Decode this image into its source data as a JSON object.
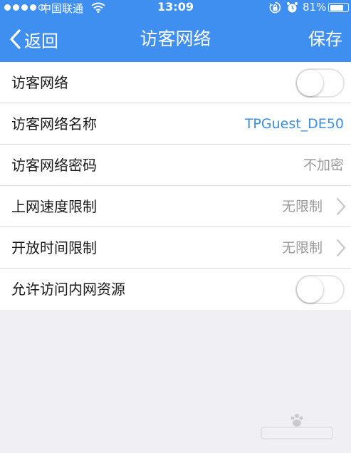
{
  "status_bar": {
    "carrier": "中国联通",
    "time": "13:09",
    "battery_percent": "81%",
    "battery_level": 0.81
  },
  "nav": {
    "back_label": "返回",
    "title": "访客网络",
    "save_label": "保存"
  },
  "settings": {
    "rows": [
      {
        "label": "访客网络",
        "control": "toggle",
        "on": false
      },
      {
        "label": "访客网络名称",
        "value": "TPGuest_DE50"
      },
      {
        "label": "访客网络密码",
        "value": "不加密"
      },
      {
        "label": "上网速度限制",
        "value": "无限制",
        "chevron": true
      },
      {
        "label": "开放时间限制",
        "value": "无限制",
        "chevron": true
      },
      {
        "label": "允许访问内网资源",
        "control": "toggle",
        "on": false
      }
    ]
  },
  "colors": {
    "header_bg": "#3e8ff0",
    "accent_text": "#3a8ee6",
    "secondary_text": "#999999",
    "page_bg": "#efeff4"
  },
  "icons": [
    "wifi-icon",
    "orientation-lock-icon",
    "alarm-icon",
    "battery-icon",
    "chevron-left-icon",
    "chevron-right-icon"
  ]
}
